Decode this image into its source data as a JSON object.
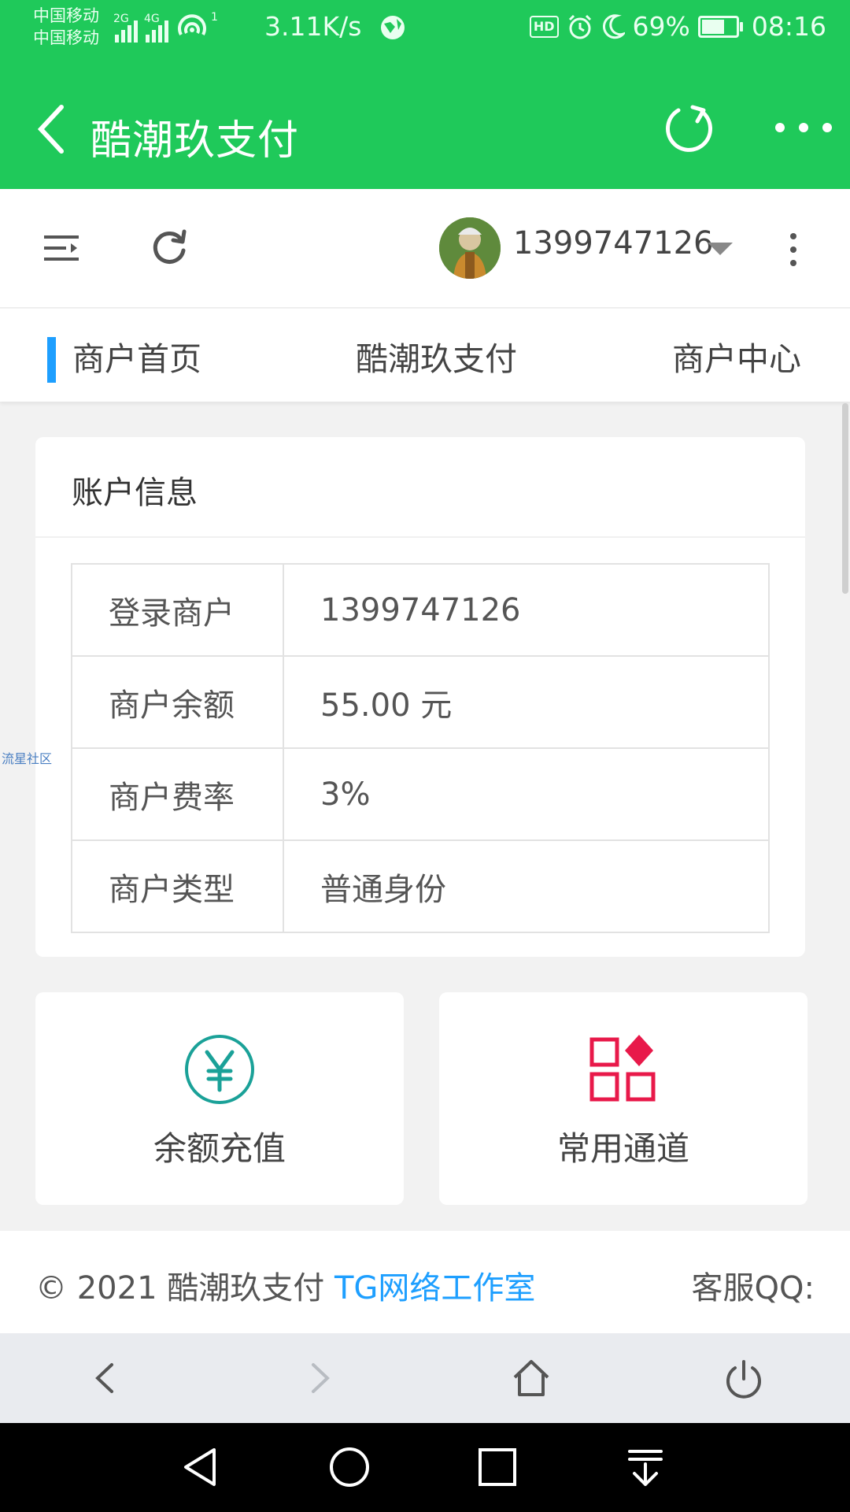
{
  "status_bar": {
    "carrier_1": "中国移动",
    "carrier_2": "中国移动",
    "net_2g": "2G",
    "net_4g": "4G",
    "hotspot_count": "1",
    "net_speed": "3.11K/s",
    "hd": "HD",
    "battery_percent": "69%",
    "battery_level": 0.69,
    "time": "08:16"
  },
  "app_header": {
    "title": "酷潮玖支付",
    "back_icon": "chevron-left-icon",
    "reload_icon": "reload-icon",
    "more_icon": "more-horizontal-icon"
  },
  "web_header": {
    "menu_icon": "menu-collapse-icon",
    "refresh_icon": "refresh-icon",
    "username": "1399747126",
    "kebab_icon": "more-vertical-icon"
  },
  "tabs": [
    {
      "label": "商户首页",
      "active": true
    },
    {
      "label": "酷潮玖支付",
      "active": false
    },
    {
      "label": "商户中心",
      "active": false
    }
  ],
  "account_card": {
    "title": "账户信息",
    "rows": [
      {
        "key": "登录商户",
        "value": "1399747126"
      },
      {
        "key": "商户余额",
        "value": "55.00 元"
      },
      {
        "key": "商户费率",
        "value": "3%"
      },
      {
        "key": "商户类型",
        "value": "普通身份"
      }
    ]
  },
  "tiles": [
    {
      "label": "余额充值",
      "icon": "yen-circle-icon",
      "color": "#1aa198"
    },
    {
      "label": "常用通道",
      "icon": "apps-grid-icon",
      "color": "#e8194a"
    }
  ],
  "footer": {
    "copyright": "© 2021 酷潮玖支付 ",
    "studio_link": "TG网络工作室",
    "service_qq": "客服QQ:"
  },
  "watermark": "流星社区",
  "browser_nav": [
    "back-icon",
    "forward-icon",
    "home-icon",
    "power-icon"
  ],
  "system_nav": [
    "nav-back-icon",
    "nav-home-icon",
    "nav-recents-icon",
    "nav-notification-icon"
  ],
  "colors": {
    "header_green": "#1fc95a",
    "accent_blue": "#1e9fff"
  }
}
